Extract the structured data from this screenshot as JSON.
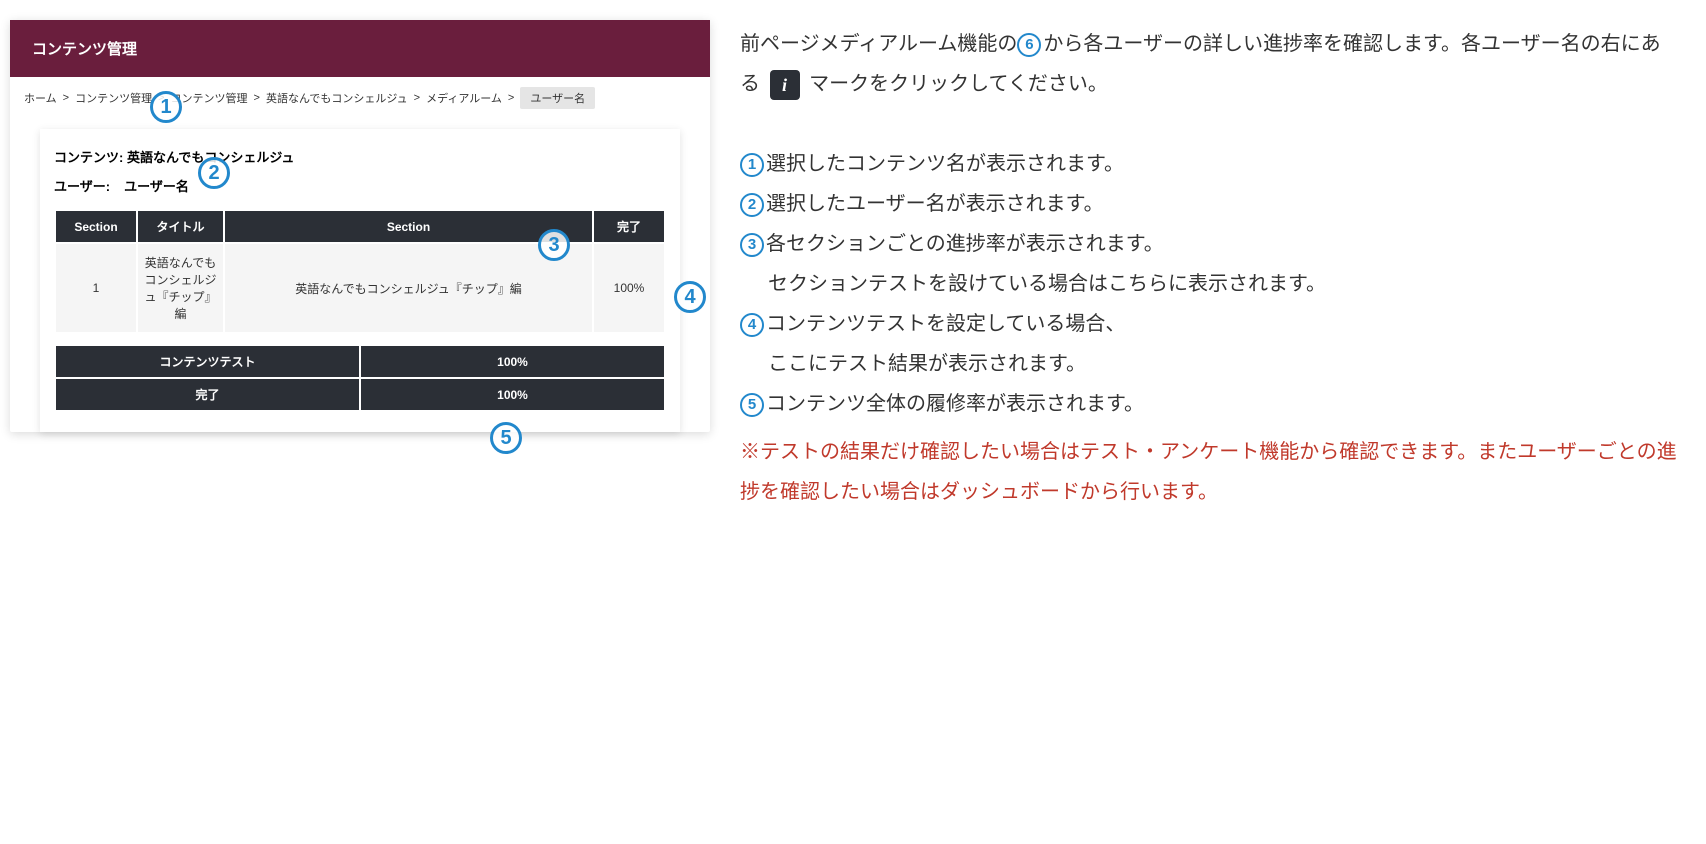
{
  "app": {
    "title": "コンテンツ管理",
    "breadcrumb": {
      "items": [
        "ホーム",
        "コンテンツ管理",
        "コンテンツ管理",
        "英語なんでもコンシェルジュ",
        "メディアルーム"
      ],
      "last": "ユーザー名",
      "sep": ">"
    }
  },
  "card": {
    "content_label": "コンテンツ:",
    "content_value": "英語なんでもコンシェルジュ",
    "user_label": "ユーザー:",
    "user_value": "ユーザー名",
    "table": {
      "headers": [
        "Section",
        "タイトル",
        "Section",
        "完了"
      ],
      "row": {
        "section_no": "1",
        "title": "英語なんでもコンシェルジュ『チップ』編",
        "section_name": "英語なんでもコンシェルジュ『チップ』編",
        "complete": "100%"
      }
    },
    "summary": {
      "row1": {
        "label": "コンテンツテスト",
        "value": "100%"
      },
      "row2": {
        "label": "完了",
        "value": "100%"
      }
    }
  },
  "annotations": {
    "n1": "1",
    "n2": "2",
    "n3": "3",
    "n4": "4",
    "n5": "5",
    "n6": "6"
  },
  "rtext": {
    "intro_a": "前ページメディアルーム機能の",
    "intro_b": "から各ユーザーの詳しい進捗率を確認します。各ユーザー名の右にある",
    "intro_c": "マークをクリックしてください。",
    "info_glyph": "i",
    "li1": "選択したコンテンツ名が表示されます。",
    "li2": "選択したユーザー名が表示されます。",
    "li3a": "各セクションごとの進捗率が表示されます。",
    "li3b": "セクションテストを設けている場合はこちらに表示されます。",
    "li4a": "コンテンツテストを設定している場合、",
    "li4b": "ここにテスト結果が表示されます。",
    "li5": "コンテンツ全体の履修率が表示されます。",
    "warn": "※テストの結果だけ確認したい場合はテスト・アンケート機能から確認できます。またユーザーごとの進捗を確認したい場合はダッシュボードから行います。"
  }
}
